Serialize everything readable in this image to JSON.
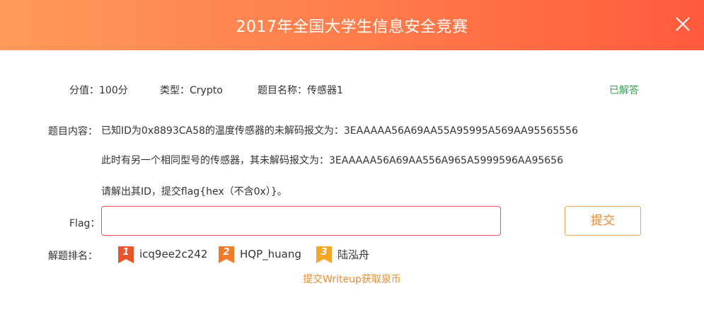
{
  "modal": {
    "title": "2017年全国大学生信息安全竞赛"
  },
  "meta": {
    "score": "分值：100分",
    "type": "类型：Crypto",
    "name": "题目名称：传感器1",
    "status": "已解答"
  },
  "content": {
    "label": "题目内容：",
    "line1": "已知ID为0x8893CA58的温度传感器的未解码报文为：3EAAAAA56A69AA55A95995A569AA95565556",
    "line2": "此时有另一个相同型号的传感器，其未解码报文为：3EAAAAA56A69AA556A965A5999596AA95656",
    "line3": "请解出其ID，提交flag{hex（不含0x）}。"
  },
  "flag": {
    "label": "Flag：",
    "value": "",
    "placeholder": "",
    "submit_label": "提交"
  },
  "ranking": {
    "label": "解题排名：",
    "entries": [
      {
        "rank": "1",
        "name": "icq9ee2c242",
        "color": "#e8552a"
      },
      {
        "rank": "2",
        "name": "HQP_huang",
        "color": "#f07c2a"
      },
      {
        "rank": "3",
        "name": "陆泓舟",
        "color": "#f5a623"
      }
    ]
  },
  "writeup_link": "提交Writeup获取泉币",
  "icons": {
    "close": "close-icon",
    "medal": "medal-icon"
  }
}
